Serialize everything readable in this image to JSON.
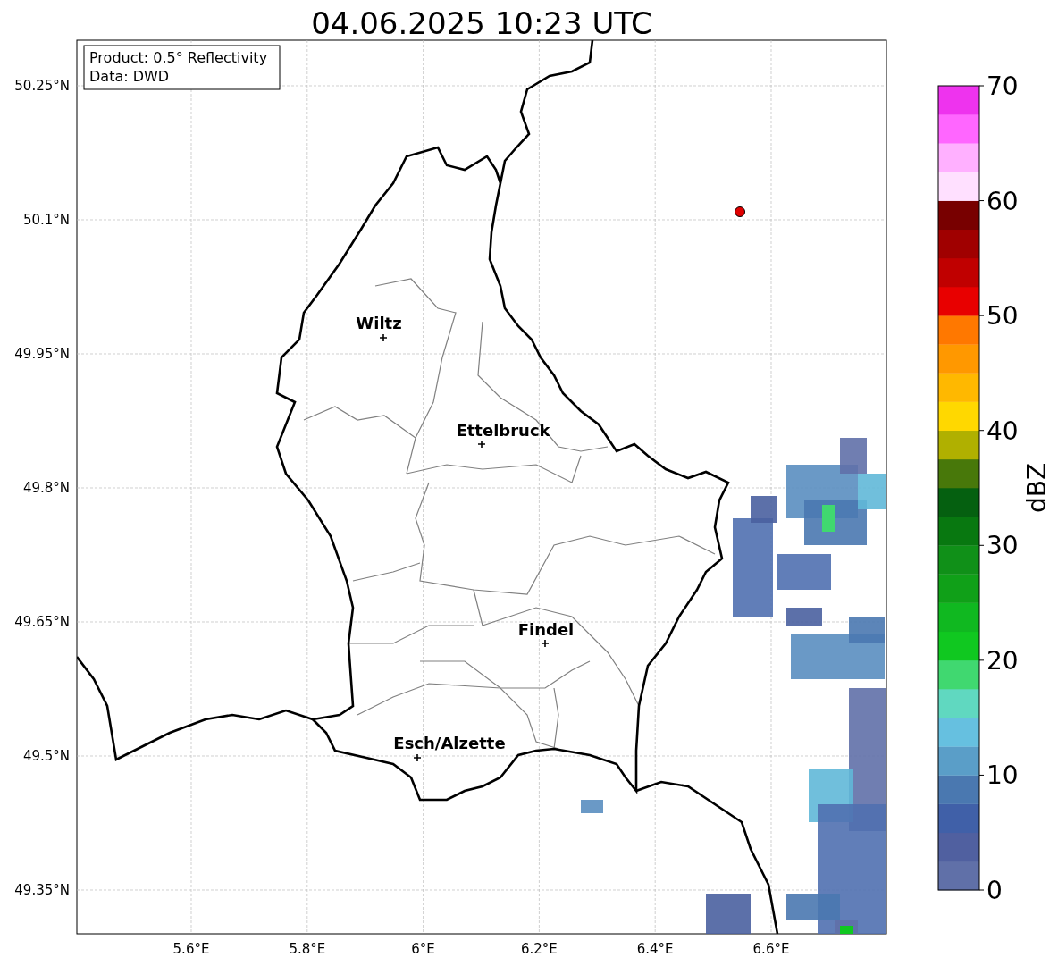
{
  "title": "04.06.2025 10:23 UTC",
  "info_box": {
    "lines": [
      "Product: 0.5° Reflectivity",
      "Data: DWD"
    ]
  },
  "map": {
    "cities": [
      {
        "name": "Wiltz"
      },
      {
        "name": "Ettelbruck"
      },
      {
        "name": "Findel"
      },
      {
        "name": "Esch/Alzette"
      }
    ],
    "x_ticks": [
      "5.6°E",
      "5.8°E",
      "6°E",
      "6.2°E",
      "6.4°E",
      "6.6°E"
    ],
    "y_ticks": [
      "50.25°N",
      "50.1°N",
      "49.95°N",
      "49.8°N",
      "49.65°N",
      "49.5°N",
      "49.35°N"
    ]
  },
  "colorbar": {
    "label": "dBZ",
    "ticks": [
      "70",
      "60",
      "50",
      "40",
      "30",
      "20",
      "10",
      "0"
    ],
    "bins": [
      {
        "color": "#6070a8"
      },
      {
        "color": "#5060a0"
      },
      {
        "color": "#4060a8"
      },
      {
        "color": "#4a78b0"
      },
      {
        "color": "#5a9ec8"
      },
      {
        "color": "#66c0e0"
      },
      {
        "color": "#60d8c0"
      },
      {
        "color": "#40d870"
      },
      {
        "color": "#10c820"
      },
      {
        "color": "#10b820"
      },
      {
        "color": "#10a018"
      },
      {
        "color": "#109018"
      },
      {
        "color": "#087810"
      },
      {
        "color": "#056010"
      },
      {
        "color": "#48780a"
      },
      {
        "color": "#b0b000"
      },
      {
        "color": "#ffd800"
      },
      {
        "color": "#ffb800"
      },
      {
        "color": "#ff9800"
      },
      {
        "color": "#ff7800"
      },
      {
        "color": "#e80000"
      },
      {
        "color": "#c00000"
      },
      {
        "color": "#a00000"
      },
      {
        "color": "#780000"
      },
      {
        "color": "#ffe0ff"
      },
      {
        "color": "#ffb0ff"
      },
      {
        "color": "#ff66ff"
      },
      {
        "color": "#ee33ee"
      }
    ]
  }
}
